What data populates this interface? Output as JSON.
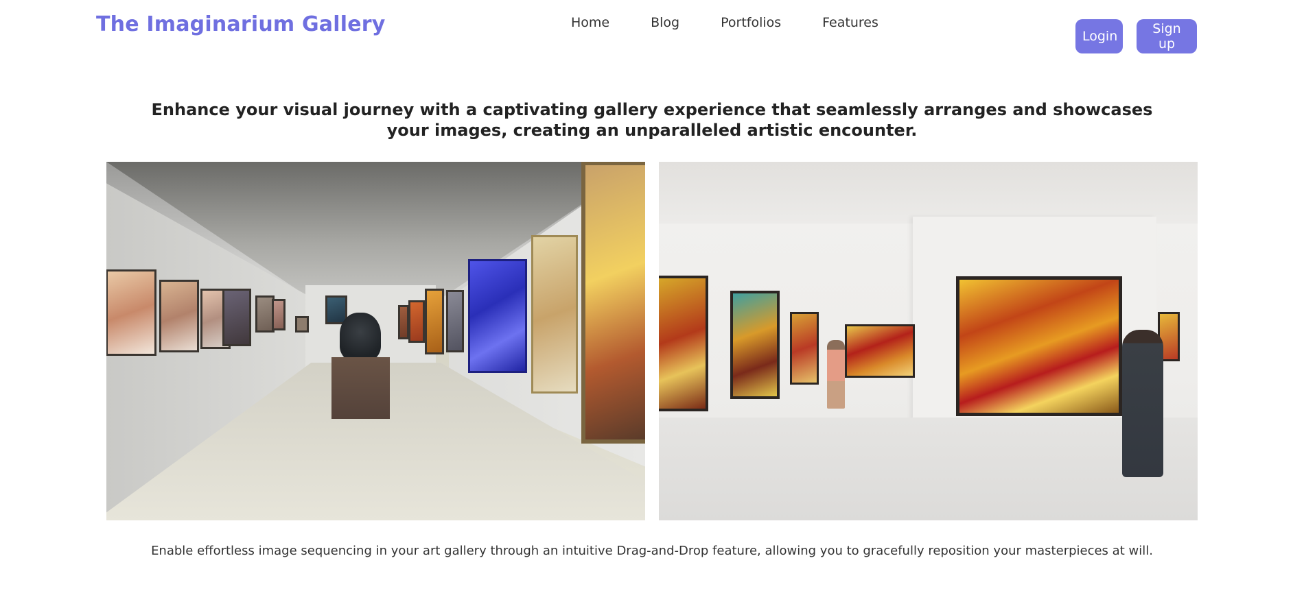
{
  "brand": {
    "title": "The Imaginarium Gallery"
  },
  "nav": {
    "items": [
      {
        "label": "Home"
      },
      {
        "label": "Blog"
      },
      {
        "label": "Portfolios"
      },
      {
        "label": "Features"
      }
    ]
  },
  "auth": {
    "login_label": "Login",
    "signup_label": "Sign up"
  },
  "hero": {
    "headline": "Enhance your visual journey with a captivating gallery experience that seamlessly arranges and showcases your images, creating an unparalleled artistic encounter."
  },
  "footer": {
    "caption": "Enable effortless image sequencing in your art gallery through an intuitive Drag-and-Drop feature, allowing you to gracefully reposition your masterpieces at will."
  },
  "colors": {
    "brand": "#6f6fe0",
    "button_bg": "#7676e3",
    "button_text": "#ffffff",
    "text": "#222222"
  }
}
